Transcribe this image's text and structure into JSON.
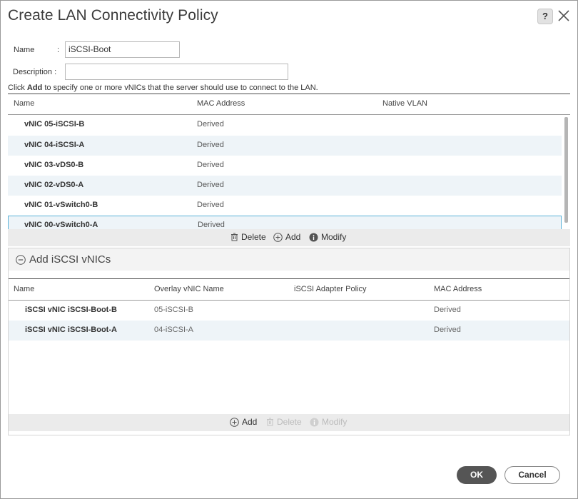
{
  "dialog": {
    "title": "Create LAN Connectivity Policy",
    "help_label": "?"
  },
  "form": {
    "name_label": "Name",
    "name_sep": ":",
    "name_value": "iSCSI-Boot",
    "description_label": "Description :",
    "description_value": ""
  },
  "hint": {
    "prefix": "Click ",
    "bold": "Add",
    "suffix": " to specify one or more vNICs that the server should use to connect to the LAN."
  },
  "vnic_table": {
    "columns": [
      "Name",
      "MAC Address",
      "Native VLAN"
    ],
    "rows": [
      {
        "name": "vNIC 05-iSCSI-B",
        "mac": "Derived"
      },
      {
        "name": "vNIC 04-iSCSI-A",
        "mac": "Derived"
      },
      {
        "name": "vNIC 03-vDS0-B",
        "mac": "Derived"
      },
      {
        "name": "vNIC 02-vDS0-A",
        "mac": "Derived"
      },
      {
        "name": "vNIC 01-vSwitch0-B",
        "mac": "Derived"
      },
      {
        "name": "vNIC 00-vSwitch0-A",
        "mac": "Derived"
      }
    ],
    "selected_index": 5,
    "toolbar": {
      "delete": "Delete",
      "add": "Add",
      "modify": "Modify"
    }
  },
  "iscsi_section": {
    "title": "Add iSCSI vNICs",
    "columns": [
      "Name",
      "Overlay vNIC Name",
      "iSCSI Adapter Policy",
      "MAC Address"
    ],
    "rows": [
      {
        "name": "iSCSI vNIC iSCSI-Boot-B",
        "overlay": "05-iSCSI-B",
        "policy": "",
        "mac": "Derived"
      },
      {
        "name": "iSCSI vNIC iSCSI-Boot-A",
        "overlay": "04-iSCSI-A",
        "policy": "",
        "mac": "Derived"
      }
    ],
    "toolbar": {
      "add": "Add",
      "delete": "Delete",
      "modify": "Modify"
    }
  },
  "footer": {
    "ok": "OK",
    "cancel": "Cancel"
  }
}
